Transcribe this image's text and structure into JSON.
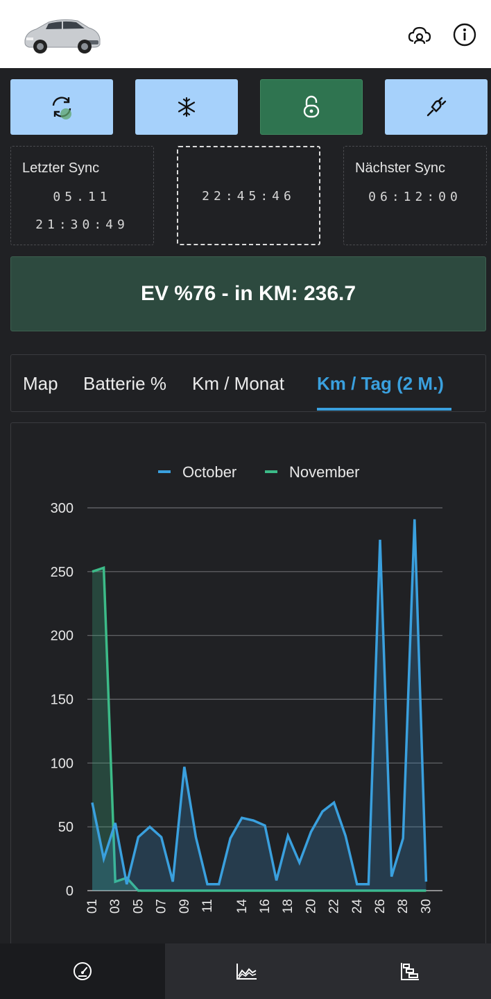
{
  "header": {
    "car_image": "car-image",
    "icons": [
      "cloud-user-icon",
      "info-icon"
    ]
  },
  "action_buttons": [
    {
      "name": "sync-button",
      "icon": "refresh-icon",
      "color": "#a6d1fb"
    },
    {
      "name": "climate-button",
      "icon": "snowflake-icon",
      "color": "#a6d1fb"
    },
    {
      "name": "lock-button",
      "icon": "unlock-icon",
      "color": "#2f7450"
    },
    {
      "name": "charge-button",
      "icon": "plug-icon",
      "color": "#a6d1fb"
    }
  ],
  "sync": {
    "last_label": "Letzter Sync",
    "last_date": "05.11",
    "last_time": "21:30:49",
    "current_time": "22:45:46",
    "next_label": "Nächster Sync",
    "next_time": "06:12:00"
  },
  "ev_status": "EV %76 - in KM: 236.7",
  "tabs": [
    {
      "label": "Map",
      "active": false
    },
    {
      "label": "Batterie %",
      "active": false
    },
    {
      "label": "Km / Monat",
      "active": false
    },
    {
      "label": "Km / Tag (2 M.)",
      "active": true
    }
  ],
  "chart_data": {
    "type": "area",
    "categories": [
      "01",
      "02",
      "03",
      "04",
      "05",
      "06",
      "07",
      "08",
      "09",
      "10",
      "11",
      "12",
      "13",
      "14",
      "15",
      "16",
      "17",
      "18",
      "19",
      "20",
      "21",
      "22",
      "23",
      "24",
      "25",
      "26",
      "27",
      "28",
      "29",
      "30",
      "31"
    ],
    "x_tick_labels": [
      "01",
      "03",
      "05",
      "07",
      "09",
      "11",
      "14",
      "16",
      "18",
      "20",
      "22",
      "24",
      "26",
      "28",
      "30"
    ],
    "ylim": [
      0,
      300
    ],
    "yticks": [
      0,
      50,
      100,
      150,
      200,
      250,
      300
    ],
    "grid": true,
    "legend": "top",
    "series": [
      {
        "name": "October",
        "color": "#3aa0de",
        "values": [
          69,
          25,
          53,
          5,
          42,
          50,
          42,
          7,
          97,
          42,
          5,
          5,
          41,
          57,
          55,
          51,
          8,
          43,
          22,
          46,
          62,
          69,
          43,
          5,
          5,
          275,
          11,
          41,
          291,
          7
        ]
      },
      {
        "name": "November",
        "color": "#3cbb88",
        "values": [
          250,
          253,
          7,
          10,
          0,
          0,
          0,
          0,
          0,
          0,
          0,
          0,
          0,
          0,
          0,
          0,
          0,
          0,
          0,
          0,
          0,
          0,
          0,
          0,
          0,
          0,
          0,
          0,
          0,
          0
        ]
      }
    ]
  },
  "bottom_nav": [
    {
      "name": "nav-dashboard",
      "icon": "speedometer-icon",
      "active": true
    },
    {
      "name": "nav-stats",
      "icon": "area-chart-icon",
      "active": false
    },
    {
      "name": "nav-timeline",
      "icon": "gantt-icon",
      "active": false
    }
  ]
}
